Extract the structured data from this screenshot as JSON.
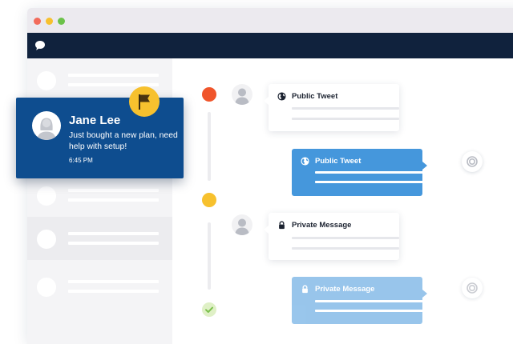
{
  "window": {
    "controls": [
      {
        "name": "close",
        "color": "#f26b5b"
      },
      {
        "name": "minimize",
        "color": "#f7c12e"
      },
      {
        "name": "maximize",
        "color": "#6cc24a"
      }
    ]
  },
  "navbar": {
    "logo_icon": "chat-bubble-icon"
  },
  "sidebar": {
    "row_count": 6
  },
  "conversation_card": {
    "name": "Jane Lee",
    "message": "Just bought a new plan, need help with setup!",
    "time": "6:45 PM",
    "flag_icon": "flag-icon",
    "accent_color": "#0e4d8f",
    "flag_badge_color": "#f7c12e"
  },
  "timeline": {
    "status_dots": [
      {
        "state": "new",
        "color": "#f0552b"
      },
      {
        "state": "pending",
        "color": "#f7c12e"
      },
      {
        "state": "resolved",
        "color": "#dff0c6",
        "icon": "check-icon"
      }
    ],
    "messages": [
      {
        "type": "incoming",
        "title": "Public Tweet",
        "icon": "globe-icon"
      },
      {
        "type": "outgoing",
        "title": "Public Tweet",
        "icon": "globe-icon"
      },
      {
        "type": "incoming",
        "title": "Private Message",
        "icon": "lock-icon"
      },
      {
        "type": "outgoing",
        "title": "Private Message",
        "icon": "lock-icon"
      }
    ]
  },
  "colors": {
    "navbar": "#10223d",
    "outgoing_bubble": "#4597dc",
    "sidebar": "#f4f4f6"
  }
}
